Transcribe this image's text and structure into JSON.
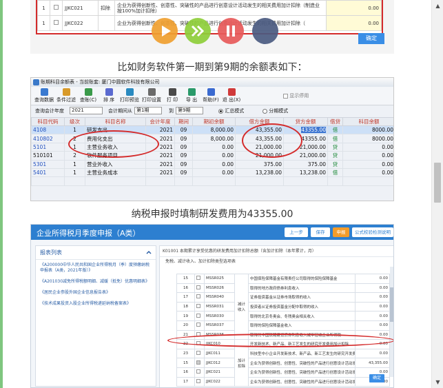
{
  "image1": {
    "rows": [
      {
        "num": "1",
        "code": "JJKC021",
        "cat": "扣除",
        "desc": "企业为获得创新性、创意性、突破性的产品进行创意设计活动发生的相关费用加计扣除（制造业按100%加计扣除）",
        "value": "0.00"
      },
      {
        "num": "1",
        "code": "JJKC022",
        "cat": "",
        "desc": "企业为获得创新性、创意性、突破性的产品进行创意设计活动发生的相关费用加计扣除（",
        "value": "0.00"
      }
    ],
    "confirm_label": "确定",
    "player_colors": [
      "#f0a030",
      "#8fcf3a",
      "#e85a5a",
      "#4a5a80"
    ]
  },
  "caption1": "比如财务软件第一期到第9期的余额表如下：",
  "software": {
    "title": "账期科目余额表 - 当前账套: 厦门中圆软件科技有限公司",
    "toolbar": [
      {
        "label": "查询数据",
        "icon": "search-icon",
        "color": "#3a7ad0"
      },
      {
        "label": "条件过滤",
        "icon": "filter-icon",
        "color": "#d89a2a"
      },
      {
        "label": "查账(C)",
        "icon": "book-icon",
        "color": "#3a9a4a"
      },
      {
        "label": "排 序",
        "icon": "sort-icon",
        "color": "#5a6ad0"
      },
      {
        "label": "打印预览",
        "icon": "preview-icon",
        "color": "#2a8ac0"
      },
      {
        "label": "打印设置",
        "icon": "printer-settings-icon",
        "color": "#6a6a6a"
      },
      {
        "label": "打 印",
        "icon": "printer-icon",
        "color": "#4a4a4a"
      },
      {
        "label": "导 出",
        "icon": "export-icon",
        "color": "#2a9a6a"
      },
      {
        "label": "帮助(F)",
        "icon": "help-icon",
        "color": "#3a6ad0"
      },
      {
        "label": "退 出(X)",
        "icon": "exit-icon",
        "color": "#d03a3a"
      }
    ],
    "show_disabled_label": "显示停用",
    "filter": {
      "year_label": "查询会计年度",
      "year_value": "2021",
      "period_label": "会计期间从",
      "period_from": "第1期",
      "to_label": "到",
      "period_to": "第9期",
      "mode1": "汇总模式",
      "mode2": "分期模式"
    },
    "columns": [
      "科目代码",
      "级次",
      "科目名称",
      "会计年度",
      "期间",
      "期初余额",
      "借方金额",
      "贷方金额",
      "借贷",
      "科目余额"
    ],
    "rows": [
      [
        "4108",
        "1",
        "研发支出",
        "2021",
        "09",
        "8,000.00",
        "43,355.00",
        "43355.00",
        "借",
        "8000.00"
      ],
      [
        "410802",
        "2",
        "费用化支出",
        "2021",
        "09",
        "8,000.00",
        "43,355.00",
        "43355.00",
        "借",
        "8000.00"
      ],
      [
        "5101",
        "1",
        "主营业务收入",
        "2021",
        "09",
        "0.00",
        "21,000.00",
        "21,000.00",
        "贷",
        "0.00"
      ],
      [
        "510101",
        "2",
        "软件服务项目",
        "2021",
        "09",
        "0.00",
        "21,000.00",
        "21,000.00",
        "贷",
        "0.00"
      ],
      [
        "5301",
        "1",
        "营业外收入",
        "2021",
        "09",
        "0.00",
        "375.00",
        "375.00",
        "贷",
        "0.00"
      ],
      [
        "5401",
        "1",
        "主营业务成本",
        "2021",
        "09",
        "0.00",
        "13,238.00",
        "13,238.00",
        "借",
        "0.00"
      ],
      [
        "",
        "",
        "",
        "",
        "",
        "",
        "",
        "",
        "",
        ""
      ]
    ]
  },
  "caption2": "纳税申报时填制研发费用为43355.00",
  "taxform": {
    "title": "企业所得税月季度申报（A类）",
    "buttons": [
      {
        "label": "上一步",
        "color": "#ffffff",
        "text": "#2d7fd0"
      },
      {
        "label": "保存",
        "color": "#ffffff",
        "text": "#2d7fd0"
      },
      {
        "label": "申报",
        "color": "#f39c2a",
        "text": "#ffffff"
      },
      {
        "label": "公式校验检测说明",
        "color": "#ffffff",
        "text": "#2d7fd0"
      }
    ],
    "side_title": "报表列表",
    "side_items": [
      "《A200000中华人民共和国企业所得税月（季）度预缴纳税申报表（A类，2021年版）》",
      "《A201030减免所得税额明细、减缓（抵免）优惠明细表》",
      "《居民企业参股外国企业信息报告表》",
      "《技术成果投资入股企业所得税递延纳税备案表》"
    ],
    "form_top": "K01001  本期累计享受优惠的研发费用加计扣除总额（含加计扣除（本年累计，月）",
    "form_sub": "免税、减计收入、加计扣除类型选项表",
    "rows": [
      {
        "n": "15",
        "code": "MSSR025",
        "desc": "中国保险保障基金有限责任公司取得的保险保障基金",
        "value": "0.00"
      },
      {
        "n": "16",
        "code": "MSSR026",
        "desc": "取得的地方政府债券利息收入",
        "value": "0.00"
      },
      {
        "n": "17",
        "code": "MSSR040",
        "desc": "证券投资基金从证券市场取得的收入",
        "value": "0.00"
      },
      {
        "n": "18",
        "code": "MSSR031",
        "desc": "投资者从证券投资基金分配中取得的收入",
        "value": "0.00"
      },
      {
        "n": "19",
        "code": "MSSR030",
        "desc": "取得的北京冬奥会、冬残奥会相关收入",
        "value": "0.00"
      },
      {
        "n": "20",
        "code": "MSSR037",
        "desc": "取得的保险保障基金收入",
        "value": "0.00"
      },
      {
        "n": "21",
        "code": "MSSR036",
        "desc": "取得的中国铁路建设债券利息收入减半征收企业所得税",
        "value": "0.00"
      },
      {
        "n": "22",
        "code": "JJKC010",
        "desc": "开发新技术、新产品、新工艺发生的研究开发费用加计扣除",
        "value": "0.00"
      },
      {
        "n": "23",
        "code": "JJKC011",
        "desc": "科技型中小企业开发新技术、新产品、新工艺发生的研究开发费用加计扣除",
        "value": "0.00"
      },
      {
        "n": "15",
        "code": "JJKC012",
        "desc": "企业为获得创新性、创意性、突破性的产品进行创意设计活动发生的相关费用加计扣除",
        "value": "43,355.00"
      },
      {
        "n": "16",
        "code": "JJKC021",
        "desc": "企业为获得创新性、创意性、突破性的产品进行创意设计活动发生的相关费用加计扣除（制造业按100%加计扣除）",
        "value": "0.00"
      },
      {
        "n": "17",
        "code": "JJKC022",
        "desc": "企业为获得创新性、创意性、突破性的产品进行创意设计活动发生的相关费用加计扣除",
        "value": "0.00"
      }
    ],
    "group1": "加计扣除",
    "group2": "减计收入",
    "confirm_label": "确定"
  }
}
